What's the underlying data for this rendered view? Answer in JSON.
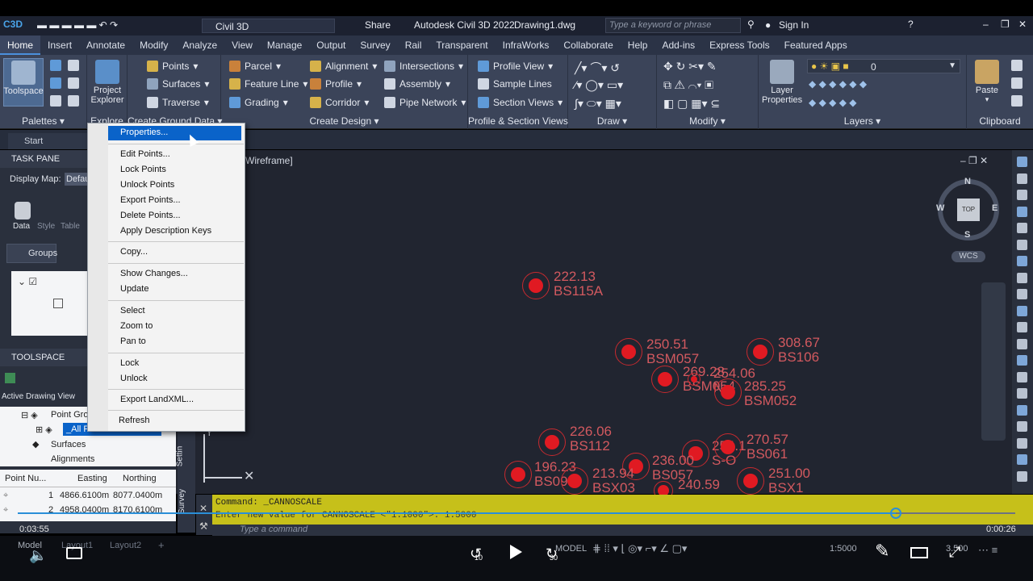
{
  "titlebar": {
    "workspace": "Civil 3D",
    "share": "Share",
    "title": "Autodesk Civil 3D 2022",
    "drawing": "Drawing1.dwg",
    "search_placeholder": "Type a keyword or phrase",
    "sign_in": "Sign In"
  },
  "menu_tabs": [
    "Home",
    "Insert",
    "Annotate",
    "Modify",
    "Analyze",
    "View",
    "Manage",
    "Output",
    "Survey",
    "Rail",
    "Transparent",
    "InfraWorks",
    "Collaborate",
    "Help",
    "Add-ins",
    "Express Tools",
    "Featured Apps"
  ],
  "ribbon": {
    "toolspace": "Toolspace",
    "project_explorer_1": "Project",
    "project_explorer_2": "Explorer",
    "palettes": "Palettes",
    "explore": "Explore",
    "points": "Points",
    "surfaces": "Surfaces",
    "traverse": "Traverse",
    "create_ground_data": "Create Ground Data",
    "parcel": "Parcel",
    "feature_line": "Feature Line",
    "grading": "Grading",
    "alignment": "Alignment",
    "profile": "Profile",
    "corridor": "Corridor",
    "intersections": "Intersections",
    "assembly": "Assembly",
    "pipe_network": "Pipe Network",
    "create_design": "Create Design",
    "profile_view": "Profile View",
    "sample_lines": "Sample Lines",
    "section_views": "Section Views",
    "profile_section_views": "Profile & Section Views",
    "draw": "Draw",
    "modify": "Modify",
    "layer_properties_1": "Layer",
    "layer_properties_2": "Properties",
    "layer_value": "0",
    "layers": "Layers",
    "paste": "Paste",
    "clipboard": "Clipboard"
  },
  "tabs": {
    "start": "Start"
  },
  "viewport_label": "Wireframe]",
  "task_pane": {
    "title": "TASK PANE",
    "display_map": "Display Map:",
    "display_value": "Defau",
    "data": "Data",
    "style": "Style",
    "table": "Table",
    "groups": "Groups"
  },
  "toolspace_panel": {
    "title": "TOOLSPACE",
    "view": "Active Drawing View",
    "point_groups": "Point Gro",
    "all_points": "_All Points",
    "surfaces": "Surfaces",
    "alignments": "Alignments"
  },
  "table": {
    "headers": [
      "Point Nu...",
      "Easting",
      "Northing"
    ],
    "rows": [
      [
        "1",
        "4866.6100m",
        "8077.0400m"
      ],
      [
        "2",
        "4958.0400m",
        "8170.6100m"
      ]
    ]
  },
  "side_tabs": {
    "settings": "Settin",
    "survey": "Survey"
  },
  "context_menu": {
    "items": [
      "Properties...",
      "Edit Points...",
      "Lock Points",
      "Unlock Points",
      "Export Points...",
      "Delete Points...",
      "Apply Description Keys",
      "Copy...",
      "Show Changes...",
      "Update",
      "Select",
      "Zoom to",
      "Pan to",
      "Lock",
      "Unlock",
      "Export LandXML...",
      "Refresh"
    ]
  },
  "viewcube": {
    "n": "N",
    "s": "S",
    "e": "E",
    "w": "W",
    "top": "TOP",
    "wcs": "WCS"
  },
  "points": [
    {
      "elev": "222.13",
      "name": "BS115A"
    },
    {
      "elev": "250.51",
      "name": "BSM057"
    },
    {
      "elev": "308.67",
      "name": "BS106"
    },
    {
      "elev": "269.28",
      "name": "BSM054"
    },
    {
      "elev": "254.06",
      "name": "N"
    },
    {
      "elev": "285.25",
      "name": "BSM052"
    },
    {
      "elev": "226.06",
      "name": "BS112"
    },
    {
      "elev": "254.1",
      "name": "S-O"
    },
    {
      "elev": "270.57",
      "name": "BS061"
    },
    {
      "elev": "236.00",
      "name": "BS057"
    },
    {
      "elev": "196.23",
      "name": "BS09"
    },
    {
      "elev": "213.94",
      "name": "BSX03"
    },
    {
      "elev": "251.00",
      "name": "BSX1"
    },
    {
      "elev": "240.59",
      "name": ""
    }
  ],
  "command": {
    "line1": "Command: _CANNOSCALE",
    "line2": "Enter new value for CANNOSCALE <\"1:1000\">: 1:5000",
    "placeholder": "Type a command"
  },
  "layout_tabs": [
    "Model",
    "Layout1",
    "Layout2"
  ],
  "status": {
    "model": "MODEL",
    "scale": "1:5000",
    "value": "3.500"
  },
  "video": {
    "elapsed": "0:03:55",
    "remaining": "0:00:26",
    "back": "10",
    "fwd": "30",
    "progress": 0.88
  },
  "colors": {
    "accent": "#0a63c9",
    "point": "#e01a22",
    "command_bar": "#c6c01a"
  }
}
